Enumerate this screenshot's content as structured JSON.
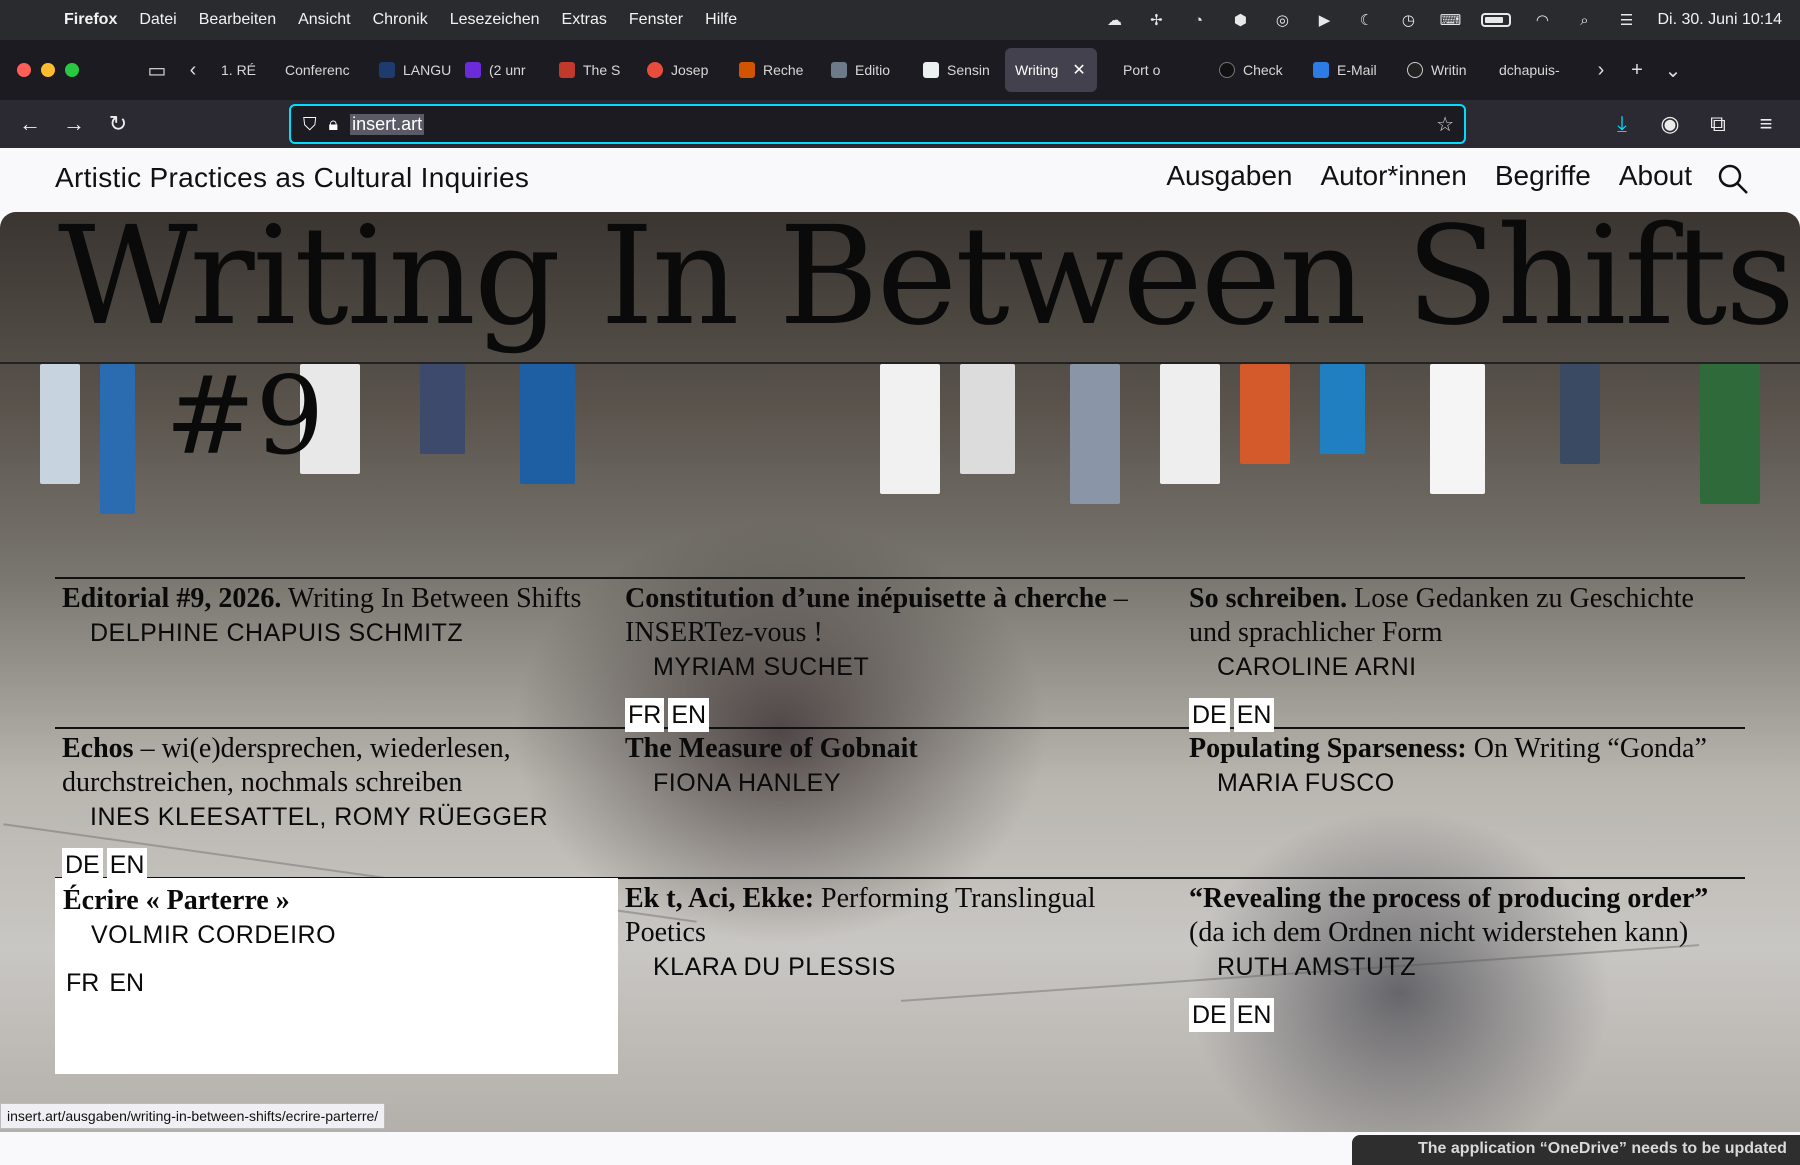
{
  "menubar": {
    "app": "Firefox",
    "items": [
      "Datei",
      "Bearbeiten",
      "Ansicht",
      "Chronik",
      "Lesezeichen",
      "Extras",
      "Fenster",
      "Hilfe"
    ],
    "datetime": "Di. 30. Juni  10:14"
  },
  "tabs": [
    {
      "label": "1. RÉ",
      "active": false
    },
    {
      "label": "Conferenc",
      "active": false
    },
    {
      "label": "LANGU",
      "active": false
    },
    {
      "label": "(2 unr",
      "active": false
    },
    {
      "label": "The S",
      "active": false
    },
    {
      "label": "Josep",
      "active": false
    },
    {
      "label": "Reche",
      "active": false
    },
    {
      "label": "Editio",
      "active": false
    },
    {
      "label": "Sensin",
      "active": false
    },
    {
      "label": "Writing",
      "active": true
    },
    {
      "label": "Port o",
      "active": false
    },
    {
      "label": "Check",
      "active": false
    },
    {
      "label": "E-Mail",
      "active": false
    },
    {
      "label": "Writin",
      "active": false
    },
    {
      "label": "dchapuis-",
      "active": false
    }
  ],
  "urlbar": {
    "url": "insert.art"
  },
  "site": {
    "title": "Artistic Practices as Cultural Inquiries",
    "nav": [
      "Ausgaben",
      "Autor*innen",
      "Begriffe",
      "About"
    ]
  },
  "hero": {
    "title": "Writing In Between Shifts",
    "number": "#9"
  },
  "entries": [
    {
      "title": "Editorial #9, 2026.",
      "subtitle": "Writing In Between Shifts",
      "authors": "DELPHINE CHAPUIS SCHMITZ",
      "langs": []
    },
    {
      "title": "Constitution d’une inépuisette à cherche",
      "subtitle": "– INSERTez-vous !",
      "authors": "MYRIAM SUCHET",
      "langs": [
        "FR",
        "EN"
      ]
    },
    {
      "title": "So schreiben.",
      "subtitle": "Lose Gedanken zu Geschichte und sprachlicher Form",
      "authors": "CAROLINE ARNI",
      "langs": [
        "DE",
        "EN"
      ]
    },
    {
      "title": "Echos",
      "subtitle": "– wi(e)dersprechen, wiederlesen, durchstreichen, nochmals schreiben",
      "authors": "INES KLEESATTEL,  ROMY RÜEGGER",
      "langs": [
        "DE",
        "EN"
      ]
    },
    {
      "title": "The Measure of Gobnait",
      "subtitle": "",
      "authors": "FIONA HANLEY",
      "langs": []
    },
    {
      "title": "Populating Sparseness:",
      "subtitle": "On Writing “Gonda”",
      "authors": "MARIA FUSCO",
      "langs": []
    },
    {
      "title": "Écrire « Parterre »",
      "subtitle": "",
      "authors": "VOLMIR CORDEIRO",
      "langs": [
        "FR",
        "EN"
      ]
    },
    {
      "title": "Ek t, Aci, Ekke:",
      "subtitle": "Performing Translingual Poetics",
      "authors": "KLARA DU PLESSIS",
      "langs": []
    },
    {
      "title": "“Revealing the process of producing order”",
      "subtitle": "(da ich dem Ordnen nicht widerstehen kann)",
      "authors": "RUTH AMSTUTZ",
      "langs": [
        "DE",
        "EN"
      ]
    }
  ],
  "status_url": "insert.art/ausgaben/writing-in-between-shifts/ecrire-parterre/",
  "toast": "The application “OneDrive” needs to be updated",
  "colors": {
    "url_focus": "#00ddff",
    "tab_active": "#42414d",
    "chrome_dark": "#1c1b22"
  }
}
